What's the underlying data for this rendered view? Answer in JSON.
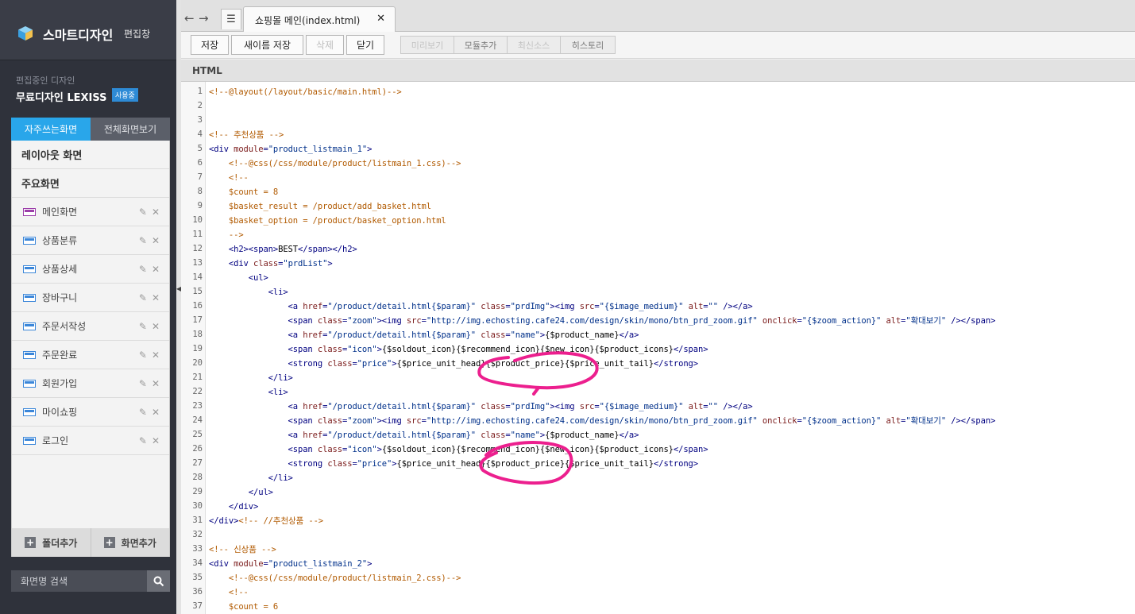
{
  "sidebar": {
    "brand_title": "스마트디자인",
    "brand_sub": "편집창",
    "editing_label": "편집중인 디자인",
    "design_name": "무료디자인 LEXISS",
    "using_badge": "사용중",
    "tab_frequent": "자주쓰는화면",
    "tab_all": "전체화면보기",
    "group_layout": "레이아웃 화면",
    "group_main": "주요화면",
    "items": [
      {
        "label": "메인화면",
        "icon": "main-page-icon"
      },
      {
        "label": "상품분류",
        "icon": "page-icon"
      },
      {
        "label": "상품상세",
        "icon": "page-icon"
      },
      {
        "label": "장바구니",
        "icon": "page-icon"
      },
      {
        "label": "주문서작성",
        "icon": "page-icon"
      },
      {
        "label": "주문완료",
        "icon": "page-icon"
      },
      {
        "label": "회원가입",
        "icon": "page-icon"
      },
      {
        "label": "마이쇼핑",
        "icon": "page-icon"
      },
      {
        "label": "로그인",
        "icon": "page-icon"
      }
    ],
    "add_folder": "폴더추가",
    "add_screen": "화면추가",
    "search_placeholder": "화면명 검색"
  },
  "main": {
    "file_tab_label": "쇼핑몰 메인(index.html)",
    "toolbar": {
      "save": "저장",
      "save_as": "새이름 저장",
      "delete": "삭제",
      "close": "닫기",
      "preview": "미리보기",
      "add_module": "모듈추가",
      "latest_source": "최신소스",
      "history": "히스토리"
    },
    "section_label": "HTML",
    "code_lines": [
      [
        [
          "c-com",
          "<!--@layout(/layout/basic/main.html)-->"
        ]
      ],
      [],
      [],
      [
        [
          "c-com",
          "<!-- 추천상품 -->"
        ]
      ],
      [
        [
          "c-tag",
          "<div "
        ],
        [
          "c-attr",
          "module"
        ],
        [
          "c-tag",
          "="
        ],
        [
          "c-str",
          "\"product_listmain_1\""
        ],
        [
          "c-tag",
          ">"
        ]
      ],
      [
        [
          "c-txt",
          "    "
        ],
        [
          "c-com",
          "<!--@css(/css/module/product/listmain_1.css)-->"
        ]
      ],
      [
        [
          "c-txt",
          "    "
        ],
        [
          "c-com",
          "<!--"
        ]
      ],
      [
        [
          "c-txt",
          "    "
        ],
        [
          "c-com",
          "$count = 8"
        ]
      ],
      [
        [
          "c-txt",
          "    "
        ],
        [
          "c-com",
          "$basket_result = /product/add_basket.html"
        ]
      ],
      [
        [
          "c-txt",
          "    "
        ],
        [
          "c-com",
          "$basket_option = /product/basket_option.html"
        ]
      ],
      [
        [
          "c-txt",
          "    "
        ],
        [
          "c-com",
          "-->"
        ]
      ],
      [
        [
          "c-txt",
          "    "
        ],
        [
          "c-tag",
          "<h2><span>"
        ],
        [
          "c-txt",
          "BEST"
        ],
        [
          "c-tag",
          "</span></h2>"
        ]
      ],
      [
        [
          "c-txt",
          "    "
        ],
        [
          "c-tag",
          "<div "
        ],
        [
          "c-attr",
          "class"
        ],
        [
          "c-tag",
          "="
        ],
        [
          "c-str",
          "\"prdList\""
        ],
        [
          "c-tag",
          ">"
        ]
      ],
      [
        [
          "c-txt",
          "        "
        ],
        [
          "c-tag",
          "<ul>"
        ]
      ],
      [
        [
          "c-txt",
          "            "
        ],
        [
          "c-tag",
          "<li>"
        ]
      ],
      [
        [
          "c-txt",
          "                "
        ],
        [
          "c-tag",
          "<a "
        ],
        [
          "c-attr",
          "href"
        ],
        [
          "c-tag",
          "="
        ],
        [
          "c-str",
          "\"/product/detail.html{$param}\""
        ],
        [
          "c-txt",
          " "
        ],
        [
          "c-attr",
          "class"
        ],
        [
          "c-tag",
          "="
        ],
        [
          "c-str",
          "\"prdImg\""
        ],
        [
          "c-tag",
          "><img "
        ],
        [
          "c-attr",
          "src"
        ],
        [
          "c-tag",
          "="
        ],
        [
          "c-str",
          "\"{$image_medium}\""
        ],
        [
          "c-txt",
          " "
        ],
        [
          "c-attr",
          "alt"
        ],
        [
          "c-tag",
          "="
        ],
        [
          "c-str",
          "\"\""
        ],
        [
          "c-tag",
          " /></a>"
        ]
      ],
      [
        [
          "c-txt",
          "                "
        ],
        [
          "c-tag",
          "<span "
        ],
        [
          "c-attr",
          "class"
        ],
        [
          "c-tag",
          "="
        ],
        [
          "c-str",
          "\"zoom\""
        ],
        [
          "c-tag",
          "><img "
        ],
        [
          "c-attr",
          "src"
        ],
        [
          "c-tag",
          "="
        ],
        [
          "c-str",
          "\"http://img.echosting.cafe24.com/design/skin/mono/btn_prd_zoom.gif\""
        ],
        [
          "c-txt",
          " "
        ],
        [
          "c-attr",
          "onclick"
        ],
        [
          "c-tag",
          "="
        ],
        [
          "c-str",
          "\"{$zoom_action}\""
        ],
        [
          "c-txt",
          " "
        ],
        [
          "c-attr",
          "alt"
        ],
        [
          "c-tag",
          "="
        ],
        [
          "c-str",
          "\"확대보기\""
        ],
        [
          "c-tag",
          " /></span>"
        ]
      ],
      [
        [
          "c-txt",
          "                "
        ],
        [
          "c-tag",
          "<a "
        ],
        [
          "c-attr",
          "href"
        ],
        [
          "c-tag",
          "="
        ],
        [
          "c-str",
          "\"/product/detail.html{$param}\""
        ],
        [
          "c-txt",
          " "
        ],
        [
          "c-attr",
          "class"
        ],
        [
          "c-tag",
          "="
        ],
        [
          "c-str",
          "\"name\""
        ],
        [
          "c-tag",
          ">"
        ],
        [
          "c-txt",
          "{$product_name}"
        ],
        [
          "c-tag",
          "</a>"
        ]
      ],
      [
        [
          "c-txt",
          "                "
        ],
        [
          "c-tag",
          "<span "
        ],
        [
          "c-attr",
          "class"
        ],
        [
          "c-tag",
          "="
        ],
        [
          "c-str",
          "\"icon\""
        ],
        [
          "c-tag",
          ">"
        ],
        [
          "c-txt",
          "{$soldout_icon}{$recommend_icon}{$new_icon}{$product_icons}"
        ],
        [
          "c-tag",
          "</span>"
        ]
      ],
      [
        [
          "c-txt",
          "                "
        ],
        [
          "c-tag",
          "<strong "
        ],
        [
          "c-attr",
          "class"
        ],
        [
          "c-tag",
          "="
        ],
        [
          "c-str",
          "\"price\""
        ],
        [
          "c-tag",
          ">"
        ],
        [
          "c-txt",
          "{$price_unit_head}{$product_price}{$price_unit_tail}"
        ],
        [
          "c-tag",
          "</strong>"
        ]
      ],
      [
        [
          "c-txt",
          "            "
        ],
        [
          "c-tag",
          "</li>"
        ]
      ],
      [
        [
          "c-txt",
          "            "
        ],
        [
          "c-tag",
          "<li>"
        ]
      ],
      [
        [
          "c-txt",
          "                "
        ],
        [
          "c-tag",
          "<a "
        ],
        [
          "c-attr",
          "href"
        ],
        [
          "c-tag",
          "="
        ],
        [
          "c-str",
          "\"/product/detail.html{$param}\""
        ],
        [
          "c-txt",
          " "
        ],
        [
          "c-attr",
          "class"
        ],
        [
          "c-tag",
          "="
        ],
        [
          "c-str",
          "\"prdImg\""
        ],
        [
          "c-tag",
          "><img "
        ],
        [
          "c-attr",
          "src"
        ],
        [
          "c-tag",
          "="
        ],
        [
          "c-str",
          "\"{$image_medium}\""
        ],
        [
          "c-txt",
          " "
        ],
        [
          "c-attr",
          "alt"
        ],
        [
          "c-tag",
          "="
        ],
        [
          "c-str",
          "\"\""
        ],
        [
          "c-tag",
          " /></a>"
        ]
      ],
      [
        [
          "c-txt",
          "                "
        ],
        [
          "c-tag",
          "<span "
        ],
        [
          "c-attr",
          "class"
        ],
        [
          "c-tag",
          "="
        ],
        [
          "c-str",
          "\"zoom\""
        ],
        [
          "c-tag",
          "><img "
        ],
        [
          "c-attr",
          "src"
        ],
        [
          "c-tag",
          "="
        ],
        [
          "c-str",
          "\"http://img.echosting.cafe24.com/design/skin/mono/btn_prd_zoom.gif\""
        ],
        [
          "c-txt",
          " "
        ],
        [
          "c-attr",
          "onclick"
        ],
        [
          "c-tag",
          "="
        ],
        [
          "c-str",
          "\"{$zoom_action}\""
        ],
        [
          "c-txt",
          " "
        ],
        [
          "c-attr",
          "alt"
        ],
        [
          "c-tag",
          "="
        ],
        [
          "c-str",
          "\"확대보기\""
        ],
        [
          "c-tag",
          " /></span>"
        ]
      ],
      [
        [
          "c-txt",
          "                "
        ],
        [
          "c-tag",
          "<a "
        ],
        [
          "c-attr",
          "href"
        ],
        [
          "c-tag",
          "="
        ],
        [
          "c-str",
          "\"/product/detail.html{$param}\""
        ],
        [
          "c-txt",
          " "
        ],
        [
          "c-attr",
          "class"
        ],
        [
          "c-tag",
          "="
        ],
        [
          "c-str",
          "\"name\""
        ],
        [
          "c-tag",
          ">"
        ],
        [
          "c-txt",
          "{$product_name}"
        ],
        [
          "c-tag",
          "</a>"
        ]
      ],
      [
        [
          "c-txt",
          "                "
        ],
        [
          "c-tag",
          "<span "
        ],
        [
          "c-attr",
          "class"
        ],
        [
          "c-tag",
          "="
        ],
        [
          "c-str",
          "\"icon\""
        ],
        [
          "c-tag",
          ">"
        ],
        [
          "c-txt",
          "{$soldout_icon}{$recommend_icon}{$new_icon}{$product_icons}"
        ],
        [
          "c-tag",
          "</span>"
        ]
      ],
      [
        [
          "c-txt",
          "                "
        ],
        [
          "c-tag",
          "<strong "
        ],
        [
          "c-attr",
          "class"
        ],
        [
          "c-tag",
          "="
        ],
        [
          "c-str",
          "\"price\""
        ],
        [
          "c-tag",
          ">"
        ],
        [
          "c-txt",
          "{$price_unit_head}{$product_price}{$price_unit_tail}"
        ],
        [
          "c-tag",
          "</strong>"
        ]
      ],
      [
        [
          "c-txt",
          "            "
        ],
        [
          "c-tag",
          "</li>"
        ]
      ],
      [
        [
          "c-txt",
          "        "
        ],
        [
          "c-tag",
          "</ul>"
        ]
      ],
      [
        [
          "c-txt",
          "    "
        ],
        [
          "c-tag",
          "</div>"
        ]
      ],
      [
        [
          "c-tag",
          "</div>"
        ],
        [
          "c-com",
          "<!-- //추천상품 -->"
        ]
      ],
      [],
      [
        [
          "c-com",
          "<!-- 신상품 -->"
        ]
      ],
      [
        [
          "c-tag",
          "<div "
        ],
        [
          "c-attr",
          "module"
        ],
        [
          "c-tag",
          "="
        ],
        [
          "c-str",
          "\"product_listmain_2\""
        ],
        [
          "c-tag",
          ">"
        ]
      ],
      [
        [
          "c-txt",
          "    "
        ],
        [
          "c-com",
          "<!--@css(/css/module/product/listmain_2.css)-->"
        ]
      ],
      [
        [
          "c-txt",
          "    "
        ],
        [
          "c-com",
          "<!--"
        ]
      ],
      [
        [
          "c-txt",
          "    "
        ],
        [
          "c-com",
          "$count = 6"
        ]
      ]
    ]
  }
}
